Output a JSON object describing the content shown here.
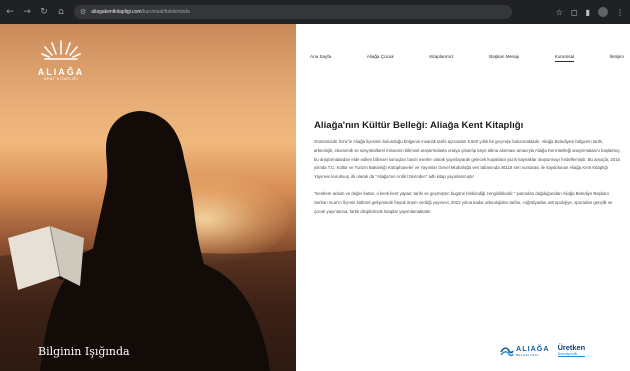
{
  "browser": {
    "url_host": "aliagakentkitapligi.com",
    "url_path": "/kurumsal/hakkimizda"
  },
  "hero": {
    "logo_word": "ALIAĞA",
    "logo_sub": "KENT KİTAPLIĞI",
    "tagline": "Bilginin Işığında"
  },
  "nav": {
    "items": [
      "Ana Sayfa",
      "Aliağa Çocuk",
      "Kitaplarımız",
      "Başkan Mesajı",
      "Kurumsal",
      "İletişim"
    ],
    "active": "Kurumsal"
  },
  "article": {
    "title": "Aliağa'nın Kültür Belleği: Aliağa Kent Kitaplığı",
    "paragraphs": [
      "Günümüzde İzmir'in Aliağa ilçesinin bulunduğu bölgenin insanlık tarihi açısından 8.500 yıllık bir geçmişe bulunmaktadır. Aliağa Belediyesi bölgenin tarihi, arkeolojik, ekonomik ve sosyokültürel mirasının bilimsel araştırmalarla ortaya çıkarılıp kayıt altına alınması amacıyla Aliağa Kent Belleği araştırmalarını başlatmış, bu araştırmalardan elde edilen bilimsel sonuçları basılı eserler olarak yayınlayarak gelecek kuşaklara yazılı kaynaklar oluşturmayı hedeflemiştir. Bu amaçla, 2015 yılında T.C. Kültür ve Turizm Bakanlığı Kütüphaneler ve Yayımlar Genel Müdürlüğü veri tabanında 46118 seri numarası ile kaydolunan Aliağa Kent Kitaplığı Yayınevi kurulmuş, ilk olarak da \"Aliağa'nın Antik İzlerinden\" adlı kitap yayınlanmıştır.",
      "\"Kentlere anlam ve değer katan, o kenti kent yapan; tarihi ve geçmişten bugüne birikimdiği zenginliklerdir.\" şiarından doğduğundan Aliağa Belediye Başkanı Serkan Acar'ın lİçenin kültürel gelişiminde büyük önem verdiği yayınevi, 2023 yılına kadar arkeolojiden tarihe, coğrafyadan antropolojiye, sporadan gençlik ve çocuk yayınlarına, farklı disiplinlerde kitaplar yayımlamaktadır."
    ]
  },
  "footer": {
    "belediye_name": "ALIAĞA",
    "belediye_sub": "BELEDİYESİ",
    "ure_name": "Üretken",
    "ure_sub": "Belediyecilik"
  },
  "colors": {
    "brand_blue": "#0e5fa8",
    "hero_sunset": "#f0b87d"
  }
}
